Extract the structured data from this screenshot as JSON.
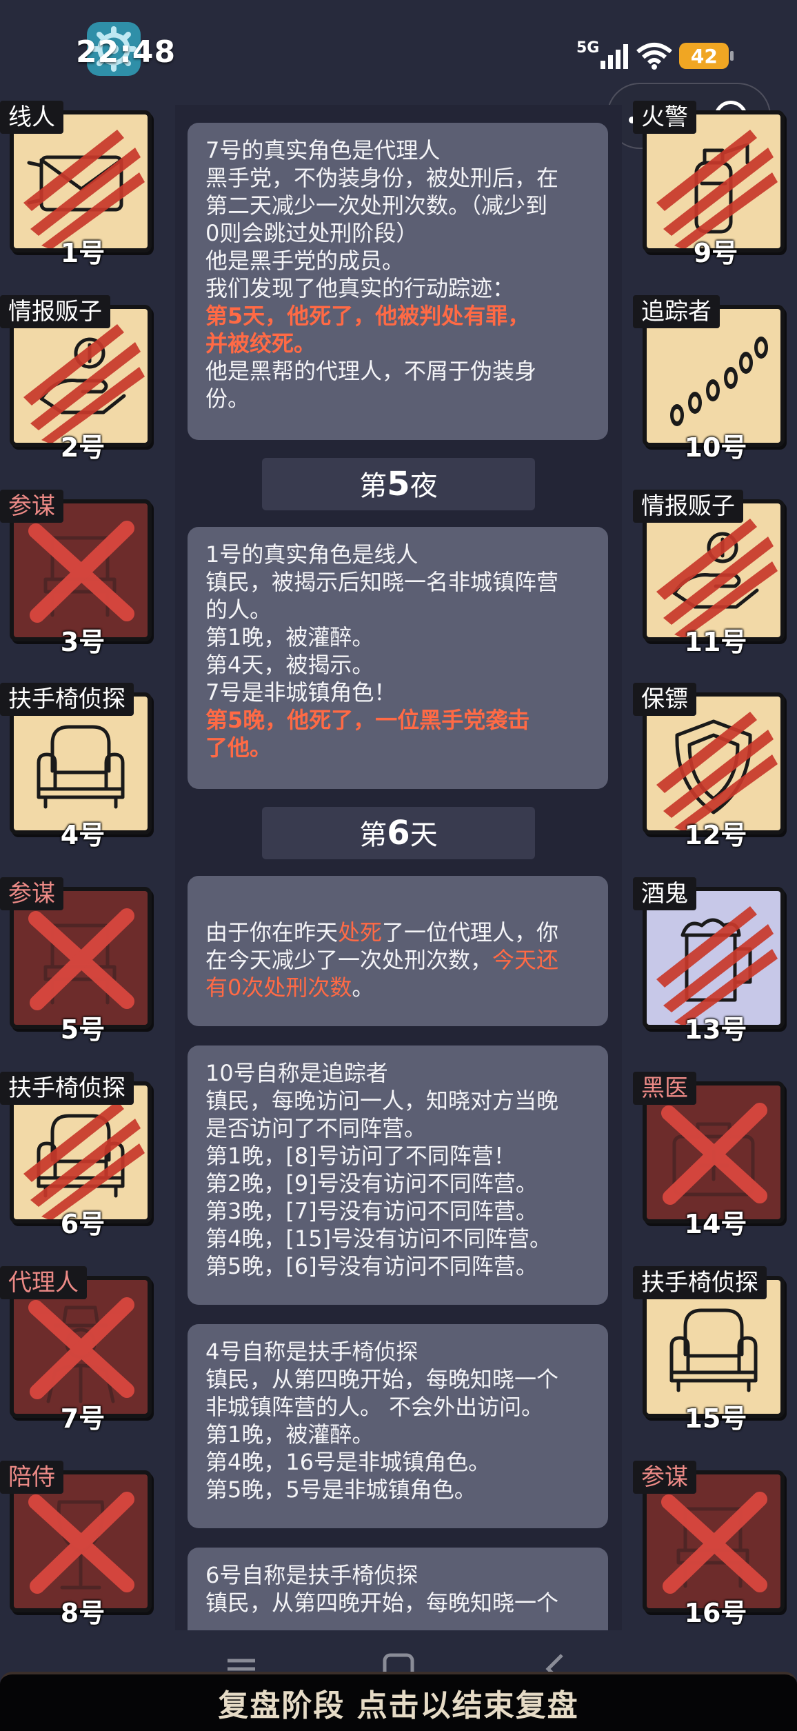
{
  "status_bar": {
    "time": "22:48",
    "network": "5G",
    "battery": "42"
  },
  "colors": {
    "background": "#272a3c",
    "card_alive": "#f2d9a7",
    "card_dead": "#6d2c2b",
    "card_drunk": "#c7c8e8",
    "highlight": "#ff6a45",
    "claw": "#c8392b"
  },
  "players": [
    {
      "number": "1号",
      "role": "线人",
      "state": "clawed",
      "icon": "envelope-icon"
    },
    {
      "number": "2号",
      "role": "情报贩子",
      "state": "clawed",
      "icon": "money-hand-icon"
    },
    {
      "number": "3号",
      "role": "参谋",
      "state": "dead",
      "icon": "chair-icon"
    },
    {
      "number": "4号",
      "role": "扶手椅侦探",
      "state": "alive",
      "icon": "armchair-icon"
    },
    {
      "number": "5号",
      "role": "参谋",
      "state": "dead",
      "icon": "chair-icon"
    },
    {
      "number": "6号",
      "role": "扶手椅侦探",
      "state": "clawed",
      "icon": "armchair-icon"
    },
    {
      "number": "7号",
      "role": "代理人",
      "state": "dead",
      "icon": "agent-icon"
    },
    {
      "number": "8号",
      "role": "陪侍",
      "state": "dead",
      "icon": "wine-glass-icon"
    },
    {
      "number": "9号",
      "role": "火警",
      "state": "clawed",
      "icon": "fire-extinguisher-icon"
    },
    {
      "number": "10号",
      "role": "追踪者",
      "state": "alive",
      "icon": "footprints-icon"
    },
    {
      "number": "11号",
      "role": "情报贩子",
      "state": "clawed",
      "icon": "money-hand-icon"
    },
    {
      "number": "12号",
      "role": "保镖",
      "state": "clawed",
      "icon": "shield-icon"
    },
    {
      "number": "13号",
      "role": "酒鬼",
      "state": "clawed-drunk",
      "icon": "beer-mug-icon"
    },
    {
      "number": "14号",
      "role": "黑医",
      "state": "dead",
      "icon": "medical-bag-icon"
    },
    {
      "number": "15号",
      "role": "扶手椅侦探",
      "state": "alive",
      "icon": "armchair-icon"
    },
    {
      "number": "16号",
      "role": "参谋",
      "state": "dead",
      "icon": "chair-icon"
    }
  ],
  "log": {
    "entry1": {
      "l1": "7号的真实角色是代理人",
      "l2": "黑手党，不伪装身份，被处刑后，在",
      "l3": "第二天减少一次处刑次数。（减少到",
      "l4": "0则会跳过处刑阶段）",
      "l5": "他是黑手党的成员。",
      "l6": "我们发现了他真实的行动踪迹：",
      "h1": "第5天，他死了，他被判处有罪，",
      "h2": "并被绞死。",
      "l7": "他是黑帮的代理人，不屑于伪装身",
      "l8": "份。"
    },
    "phase1": {
      "prefix": "第",
      "num": "5",
      "suffix": "夜"
    },
    "entry2": {
      "l1": "1号的真实角色是线人",
      "l2": "镇民，被揭示后知晓一名非城镇阵营",
      "l3": "的人。",
      "l4": "第1晚，被灌醉。",
      "l5": "第4天，被揭示。",
      "l6": "7号是非城镇角色！",
      "h1": "第5晚，他死了，一位黑手党袭击",
      "h2": "了他。"
    },
    "phase2": {
      "prefix": "第",
      "num": "6",
      "suffix": "天"
    },
    "entry3": {
      "a": "由于你在昨天",
      "b": "处死",
      "c": "了一位代理人，你",
      "d": "在今天减少了一次处刑次数，",
      "e": "今天还",
      "f": "有0次处刑次数",
      "g": "。"
    },
    "entry4": {
      "l1": "10号自称是追踪者",
      "l2": "镇民，每晚访问一人，知晓对方当晚",
      "l3": "是否访问了不同阵营。",
      "l4": "第1晚，[8]号访问了不同阵营！",
      "l5": "第2晚，[9]号没有访问不同阵营。",
      "l6": "第3晚，[7]号没有访问不同阵营。",
      "l7": "第4晚，[15]号没有访问不同阵营。",
      "l8": "第5晚，[6]号没有访问不同阵营。"
    },
    "entry5": {
      "l1": "4号自称是扶手椅侦探",
      "l2": "镇民，从第四晚开始，每晚知晓一个",
      "l3": "非城镇阵营的人。 不会外出访问。",
      "l4": "第1晚，被灌醉。",
      "l5": "第4晚，16号是非城镇角色。",
      "l6": "第5晚，5号是非城镇角色。"
    },
    "entry6": {
      "l1": "6号自称是扶手椅侦探",
      "l2": "镇民，从第四晚开始，每晚知晓一个"
    }
  },
  "bottom_button": "复盘阶段 点击以结束复盘"
}
